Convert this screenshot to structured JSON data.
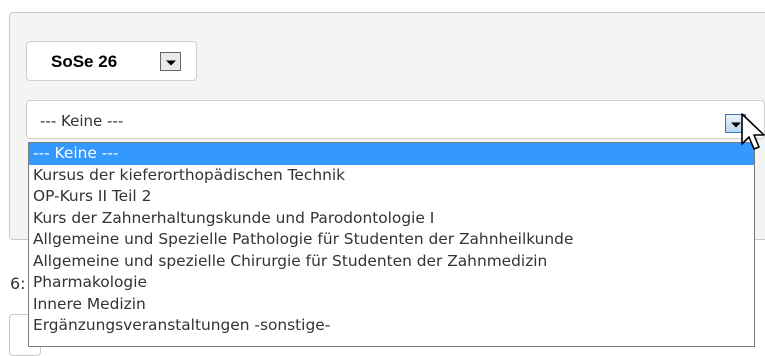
{
  "semester": {
    "value": "SoSe 26"
  },
  "course_select": {
    "value": "--- Keine ---",
    "options": [
      "--- Keine ---",
      "Kursus der kieferorthopädischen Technik",
      "OP-Kurs II Teil 2",
      "Kurs der Zahnerhaltungskunde und Parodontologie I",
      "Allgemeine und Spezielle Pathologie für Studenten der Zahnheilkunde",
      "Allgemeine und spezielle Chirurgie für Studenten der Zahnmedizin",
      "Pharmakologie",
      "Innere Medizin",
      "Ergänzungsveranstaltungen -sonstige-"
    ],
    "selected_index": 0
  },
  "background_fragment": {
    "text": "6:"
  },
  "colors": {
    "highlight": "#3399ff",
    "panel": "#f4f4f4",
    "button_active": "#bcd7ee"
  }
}
